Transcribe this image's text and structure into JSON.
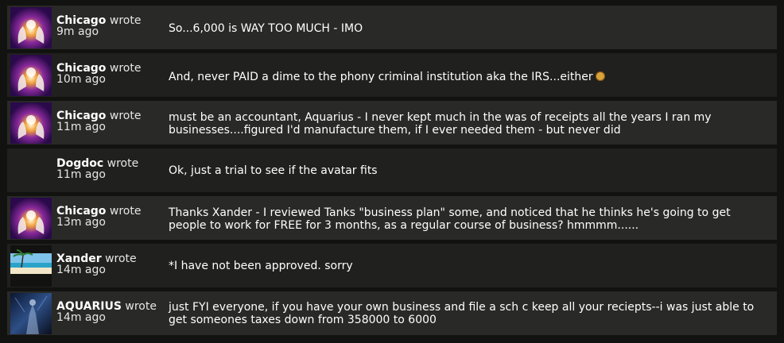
{
  "feed": {
    "posts": [
      {
        "author": "Chicago",
        "verb": "wrote",
        "ago": "9m ago",
        "message": "So...6,000 is WAY TOO MUCH - IMO",
        "avatar": "hands-light-avatar"
      },
      {
        "author": "Chicago",
        "verb": "wrote",
        "ago": "10m ago",
        "message": "And, never PAID a dime to the phony criminal institution aka the IRS...either",
        "avatar": "hands-light-avatar",
        "emoji": "laughing-face-icon"
      },
      {
        "author": "Chicago",
        "verb": "wrote",
        "ago": "11m ago",
        "message": "must be an accountant, Aquarius - I never kept much in the was of receipts all the years I ran my businesses....figured I'd manufacture them, if I ever needed them - but never did",
        "avatar": "hands-light-avatar"
      },
      {
        "author": "Dogdoc",
        "verb": "wrote",
        "ago": "11m ago",
        "message": "Ok, just a trial to see if the avatar fits",
        "avatar": "none"
      },
      {
        "author": "Chicago",
        "verb": "wrote",
        "ago": "13m ago",
        "message": "Thanks Xander - I reviewed Tanks \"business plan\" some, and noticed that he thinks he's going to get people to work for FREE for 3 months, as a regular course of business? hmmmm......",
        "avatar": "hands-light-avatar"
      },
      {
        "author": "Xander",
        "verb": "wrote",
        "ago": "14m ago",
        "message": "*I have not been approved. sorry",
        "avatar": "beach-avatar"
      },
      {
        "author": "AQUARIUS",
        "verb": "wrote",
        "ago": "14m ago",
        "message": "just FYI everyone, if you have your own business and file a sch c keep all your reciepts--i was just able to get someones taxes down from 358000 to 6000",
        "avatar": "dark-figure-avatar"
      }
    ]
  },
  "colors": {
    "background": "#121210",
    "row_odd": "#292927",
    "row_even": "#20201e",
    "text": "#ffffff"
  }
}
